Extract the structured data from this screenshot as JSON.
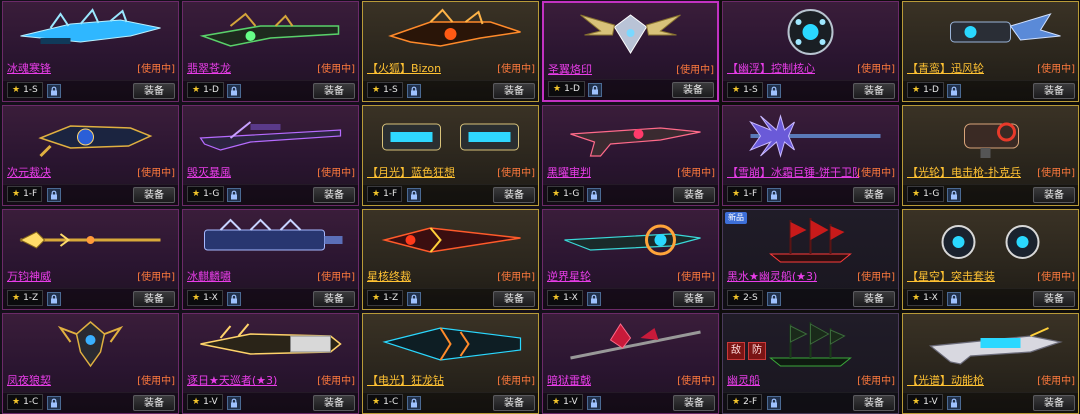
{
  "equip_label": "装备",
  "status_label": "[使用中]",
  "items_left": [
    {
      "name": "冰魂寒锋",
      "rank": "1-S",
      "art": "blue-spiky-rifle"
    },
    {
      "name": "翡翠苍龙",
      "rank": "1-D",
      "art": "green-dragon-rifle"
    },
    {
      "name": "【火狐】Bizon",
      "rank": "1-S",
      "art": "fire-fox-smg"
    },
    {
      "name": "圣翼烙印",
      "rank": "1-D",
      "art": "winged-emblem"
    },
    {
      "name": "次元裁决",
      "rank": "1-F",
      "art": "blue-gold-cannon"
    },
    {
      "name": "毁灭暴風",
      "rank": "1-G",
      "art": "purple-sniper"
    },
    {
      "name": "【月光】蓝色狂想",
      "rank": "1-F",
      "art": "twin-blue-launcher"
    },
    {
      "name": "黑曜审判",
      "rank": "1-G",
      "art": "dark-blaster"
    },
    {
      "name": "万钧神威",
      "rank": "1-Z",
      "art": "golden-spear"
    },
    {
      "name": "冰麒麟嘯",
      "rank": "1-X",
      "art": "blue-heavy-gun"
    },
    {
      "name": "星核终裁",
      "rank": "1-Z",
      "art": "red-gold-lance"
    },
    {
      "name": "逆界星轮",
      "rank": "1-X",
      "art": "cyan-wheel-gun"
    },
    {
      "name": "凤夜狼契",
      "rank": "1-C",
      "art": "gold-totem"
    },
    {
      "name": "逐日★天巡者(★3)",
      "rank": "1-V",
      "art": "gold-gatling"
    },
    {
      "name": "【电光】狂龙钻",
      "rank": "1-C",
      "art": "cyan-drill"
    },
    {
      "name": "暗狱雷戟",
      "rank": "1-V",
      "art": "crimson-halberd"
    }
  ],
  "items_right": [
    {
      "name": "【幽浮】控制核心",
      "rank": "1-S",
      "art": "orb-core"
    },
    {
      "name": "【青鸾】迅风轮",
      "rank": "1-D",
      "art": "blue-dragon-wheel"
    },
    {
      "name": "【雪崩】冰霜巨锤-饼干卫队",
      "rank": "1-F",
      "art": "frost-hammer"
    },
    {
      "name": "【光轮】电击枪-扑克兵",
      "rank": "1-G",
      "art": "shock-gun"
    },
    {
      "name": "黑水★幽灵船(★3)",
      "rank": "2-S",
      "art": "red-ghost-ship",
      "badge": "新品"
    },
    {
      "name": "【星空】突击套装",
      "rank": "1-X",
      "art": "star-gauntlets"
    },
    {
      "name": "幽灵船",
      "rank": "2-F",
      "art": "green-ghost-ship",
      "icons": [
        "敌",
        "防"
      ]
    },
    {
      "name": "【光谱】动能枪",
      "rank": "1-V",
      "art": "spectrum-gun"
    }
  ],
  "colors": {
    "purple_name": "#e83de8",
    "gold_name": "#ffc233",
    "status": "#ff7a3d",
    "star": "#f3c52b"
  }
}
